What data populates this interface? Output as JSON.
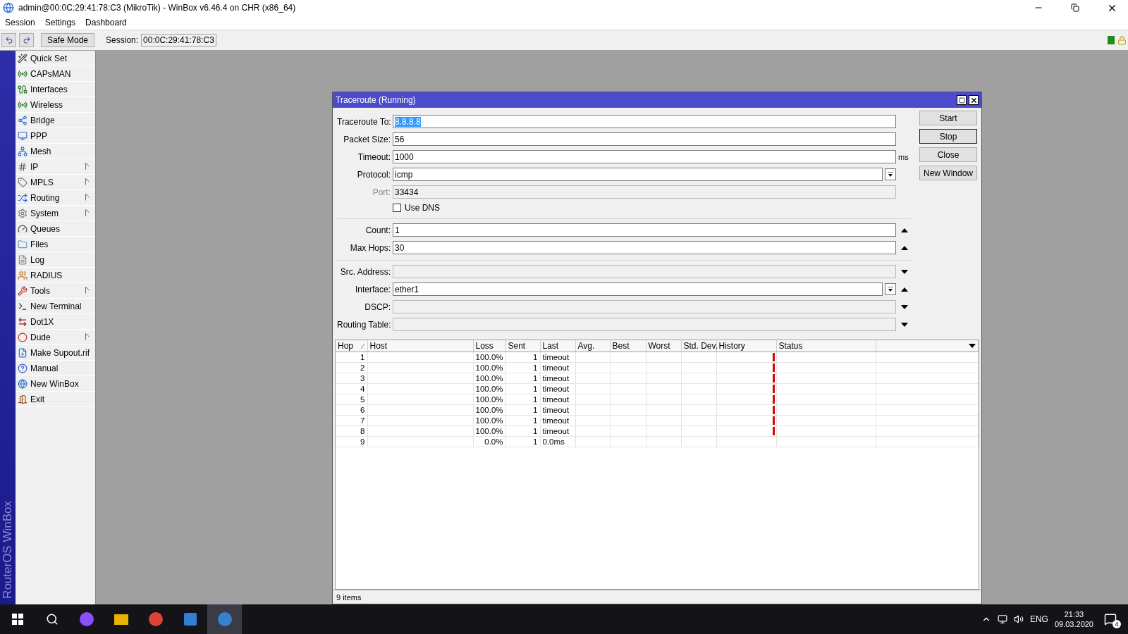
{
  "window": {
    "title": "admin@00:0C:29:41:78:C3 (MikroTik) - WinBox v6.46.4 on CHR (x86_64)"
  },
  "menu": [
    "Session",
    "Settings",
    "Dashboard"
  ],
  "toolbar": {
    "safe_mode": "Safe Mode",
    "session_label": "Session:",
    "session_value": "00:0C:29:41:78:C3"
  },
  "sidebar": {
    "brand": "RouterOS WinBox",
    "items": [
      {
        "label": "Quick Set",
        "submenu": false
      },
      {
        "label": "CAPsMAN",
        "submenu": false
      },
      {
        "label": "Interfaces",
        "submenu": false
      },
      {
        "label": "Wireless",
        "submenu": false
      },
      {
        "label": "Bridge",
        "submenu": false
      },
      {
        "label": "PPP",
        "submenu": false
      },
      {
        "label": "Mesh",
        "submenu": false
      },
      {
        "label": "IP",
        "submenu": true
      },
      {
        "label": "MPLS",
        "submenu": true
      },
      {
        "label": "Routing",
        "submenu": true
      },
      {
        "label": "System",
        "submenu": true
      },
      {
        "label": "Queues",
        "submenu": false
      },
      {
        "label": "Files",
        "submenu": false
      },
      {
        "label": "Log",
        "submenu": false
      },
      {
        "label": "RADIUS",
        "submenu": false
      },
      {
        "label": "Tools",
        "submenu": true
      },
      {
        "label": "New Terminal",
        "submenu": false
      },
      {
        "label": "Dot1X",
        "submenu": false
      },
      {
        "label": "Dude",
        "submenu": true
      },
      {
        "label": "Make Supout.rif",
        "submenu": false
      },
      {
        "label": "Manual",
        "submenu": false
      },
      {
        "label": "New WinBox",
        "submenu": false
      },
      {
        "label": "Exit",
        "submenu": false
      }
    ]
  },
  "dialog": {
    "title": "Traceroute (Running)",
    "sections": [
      [
        {
          "kind": "text",
          "label": "Traceroute To:",
          "value": "8.8.8.8",
          "highlighted": true,
          "disabled": false,
          "readonly": false,
          "spin": false,
          "dropdown": false
        },
        {
          "kind": "text",
          "label": "Packet Size:",
          "value": "56",
          "disabled": false,
          "readonly": false,
          "spin": false,
          "dropdown": false
        },
        {
          "kind": "text",
          "label": "Timeout:",
          "value": "1000",
          "unit": "ms",
          "disabled": false,
          "readonly": false,
          "spin": false,
          "dropdown": false
        },
        {
          "kind": "select",
          "label": "Protocol:",
          "value": "icmp",
          "disabled": false,
          "readonly": false,
          "spin": false,
          "dropdown": false
        },
        {
          "kind": "text",
          "label": "Port:",
          "value": "33434",
          "disabled": true,
          "readonly": true,
          "spin": false,
          "dropdown": false
        },
        {
          "kind": "check",
          "label": "Use DNS",
          "checked": false
        }
      ],
      [
        {
          "kind": "text",
          "label": "Count:",
          "value": "1",
          "disabled": false,
          "readonly": false,
          "spin": true,
          "dropdown": false
        },
        {
          "kind": "text",
          "label": "Max Hops:",
          "value": "30",
          "disabled": false,
          "readonly": false,
          "spin": true,
          "dropdown": false
        }
      ],
      [
        {
          "kind": "text",
          "label": "Src. Address:",
          "disabled": false,
          "readonly": true,
          "spin": false,
          "dropdown": true
        },
        {
          "kind": "select",
          "label": "Interface:",
          "value": "ether1",
          "disabled": false,
          "readonly": false,
          "spin": true,
          "dropdown": false
        },
        {
          "kind": "text",
          "label": "DSCP:",
          "disabled": false,
          "readonly": true,
          "spin": false,
          "dropdown": true
        },
        {
          "kind": "text",
          "label": "Routing Table:",
          "disabled": false,
          "readonly": true,
          "spin": false,
          "dropdown": true
        }
      ]
    ],
    "buttons": [
      {
        "label": "Start",
        "focused": false
      },
      {
        "label": "Stop",
        "focused": true
      },
      {
        "label": "Close",
        "focused": false
      },
      {
        "label": "New Window",
        "focused": false
      }
    ],
    "table": {
      "columns": [
        "Hop",
        "Host",
        "Loss",
        "Sent",
        "Last",
        "Avg.",
        "Best",
        "Worst",
        "Std. Dev.",
        "History",
        "Status"
      ],
      "rows": [
        {
          "hop": "1",
          "loss": "100.0%",
          "sent": "1",
          "last": "timeout",
          "history_loss": true
        },
        {
          "hop": "2",
          "loss": "100.0%",
          "sent": "1",
          "last": "timeout",
          "history_loss": true
        },
        {
          "hop": "3",
          "loss": "100.0%",
          "sent": "1",
          "last": "timeout",
          "history_loss": true
        },
        {
          "hop": "4",
          "loss": "100.0%",
          "sent": "1",
          "last": "timeout",
          "history_loss": true
        },
        {
          "hop": "5",
          "loss": "100.0%",
          "sent": "1",
          "last": "timeout",
          "history_loss": true
        },
        {
          "hop": "6",
          "loss": "100.0%",
          "sent": "1",
          "last": "timeout",
          "history_loss": true
        },
        {
          "hop": "7",
          "loss": "100.0%",
          "sent": "1",
          "last": "timeout",
          "history_loss": true
        },
        {
          "hop": "8",
          "loss": "100.0%",
          "sent": "1",
          "last": "timeout",
          "history_loss": true
        },
        {
          "hop": "9",
          "loss": "0.0%",
          "sent": "1",
          "last": "0.0ms",
          "history_loss": false
        }
      ]
    },
    "status": "9 items"
  },
  "taskbar": {
    "apps": [
      {
        "selected": false
      },
      {
        "selected": false
      },
      {
        "selected": false
      },
      {
        "selected": false
      },
      {
        "selected": true
      }
    ],
    "language": "ENG",
    "time": "21:33",
    "date": "09.03.2020",
    "notifications": "4"
  }
}
